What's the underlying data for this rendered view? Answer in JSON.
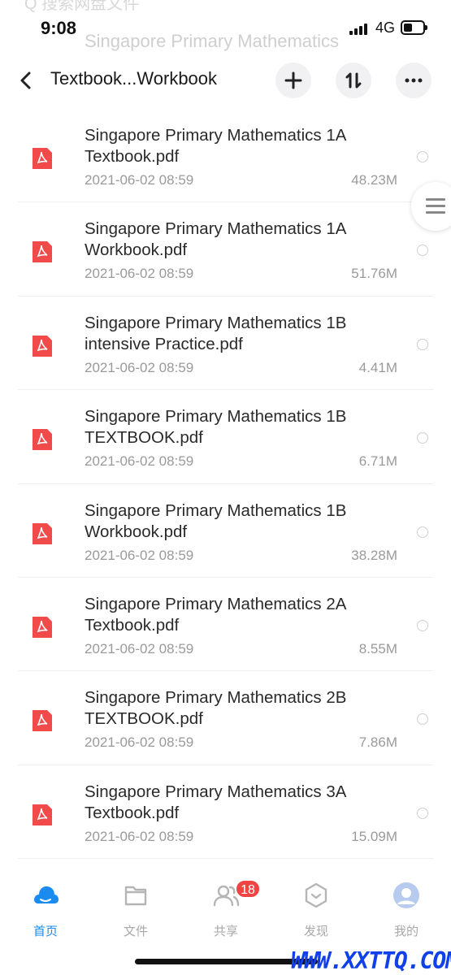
{
  "status": {
    "time": "9:08",
    "network": "4G"
  },
  "ghost": {
    "top_text": "Q 搜索网盘文件",
    "title": "Singapore Primary Mathematics"
  },
  "header": {
    "title": "Textbook...Workbook"
  },
  "files": [
    {
      "name": "Singapore Primary Mathematics 1A Textbook.pdf",
      "date": "2021-06-02 08:59",
      "size": "48.23M"
    },
    {
      "name": "Singapore Primary Mathematics 1A Workbook.pdf",
      "date": "2021-06-02 08:59",
      "size": "51.76M"
    },
    {
      "name": "Singapore Primary Mathematics 1B intensive Practice.pdf",
      "date": "2021-06-02 08:59",
      "size": "4.41M"
    },
    {
      "name": "Singapore Primary Mathematics 1B TEXTBOOK.pdf",
      "date": "2021-06-02 08:59",
      "size": "6.71M"
    },
    {
      "name": "Singapore Primary Mathematics 1B Workbook.pdf",
      "date": "2021-06-02 08:59",
      "size": "38.28M"
    },
    {
      "name": "Singapore Primary Mathematics 2A Textbook.pdf",
      "date": "2021-06-02 08:59",
      "size": "8.55M"
    },
    {
      "name": "Singapore Primary Mathematics 2B TEXTBOOK.pdf",
      "date": "2021-06-02 08:59",
      "size": "7.86M"
    },
    {
      "name": "Singapore Primary Mathematics 3A Textbook.pdf",
      "date": "2021-06-02 08:59",
      "size": "15.09M"
    }
  ],
  "tabs": [
    {
      "label": "首页",
      "icon": "cloud-icon"
    },
    {
      "label": "文件",
      "icon": "folder-icon"
    },
    {
      "label": "共享",
      "icon": "people-icon"
    },
    {
      "label": "发现",
      "icon": "discover-icon"
    },
    {
      "label": "我的",
      "icon": "avatar-icon"
    }
  ],
  "share_badge": "18",
  "watermark": "WWW.XXTTQ.COM",
  "colors": {
    "accent": "#1a8cf0",
    "pdf": "#f04a4a",
    "badge": "#f04343",
    "watermark": "#1040e8"
  }
}
